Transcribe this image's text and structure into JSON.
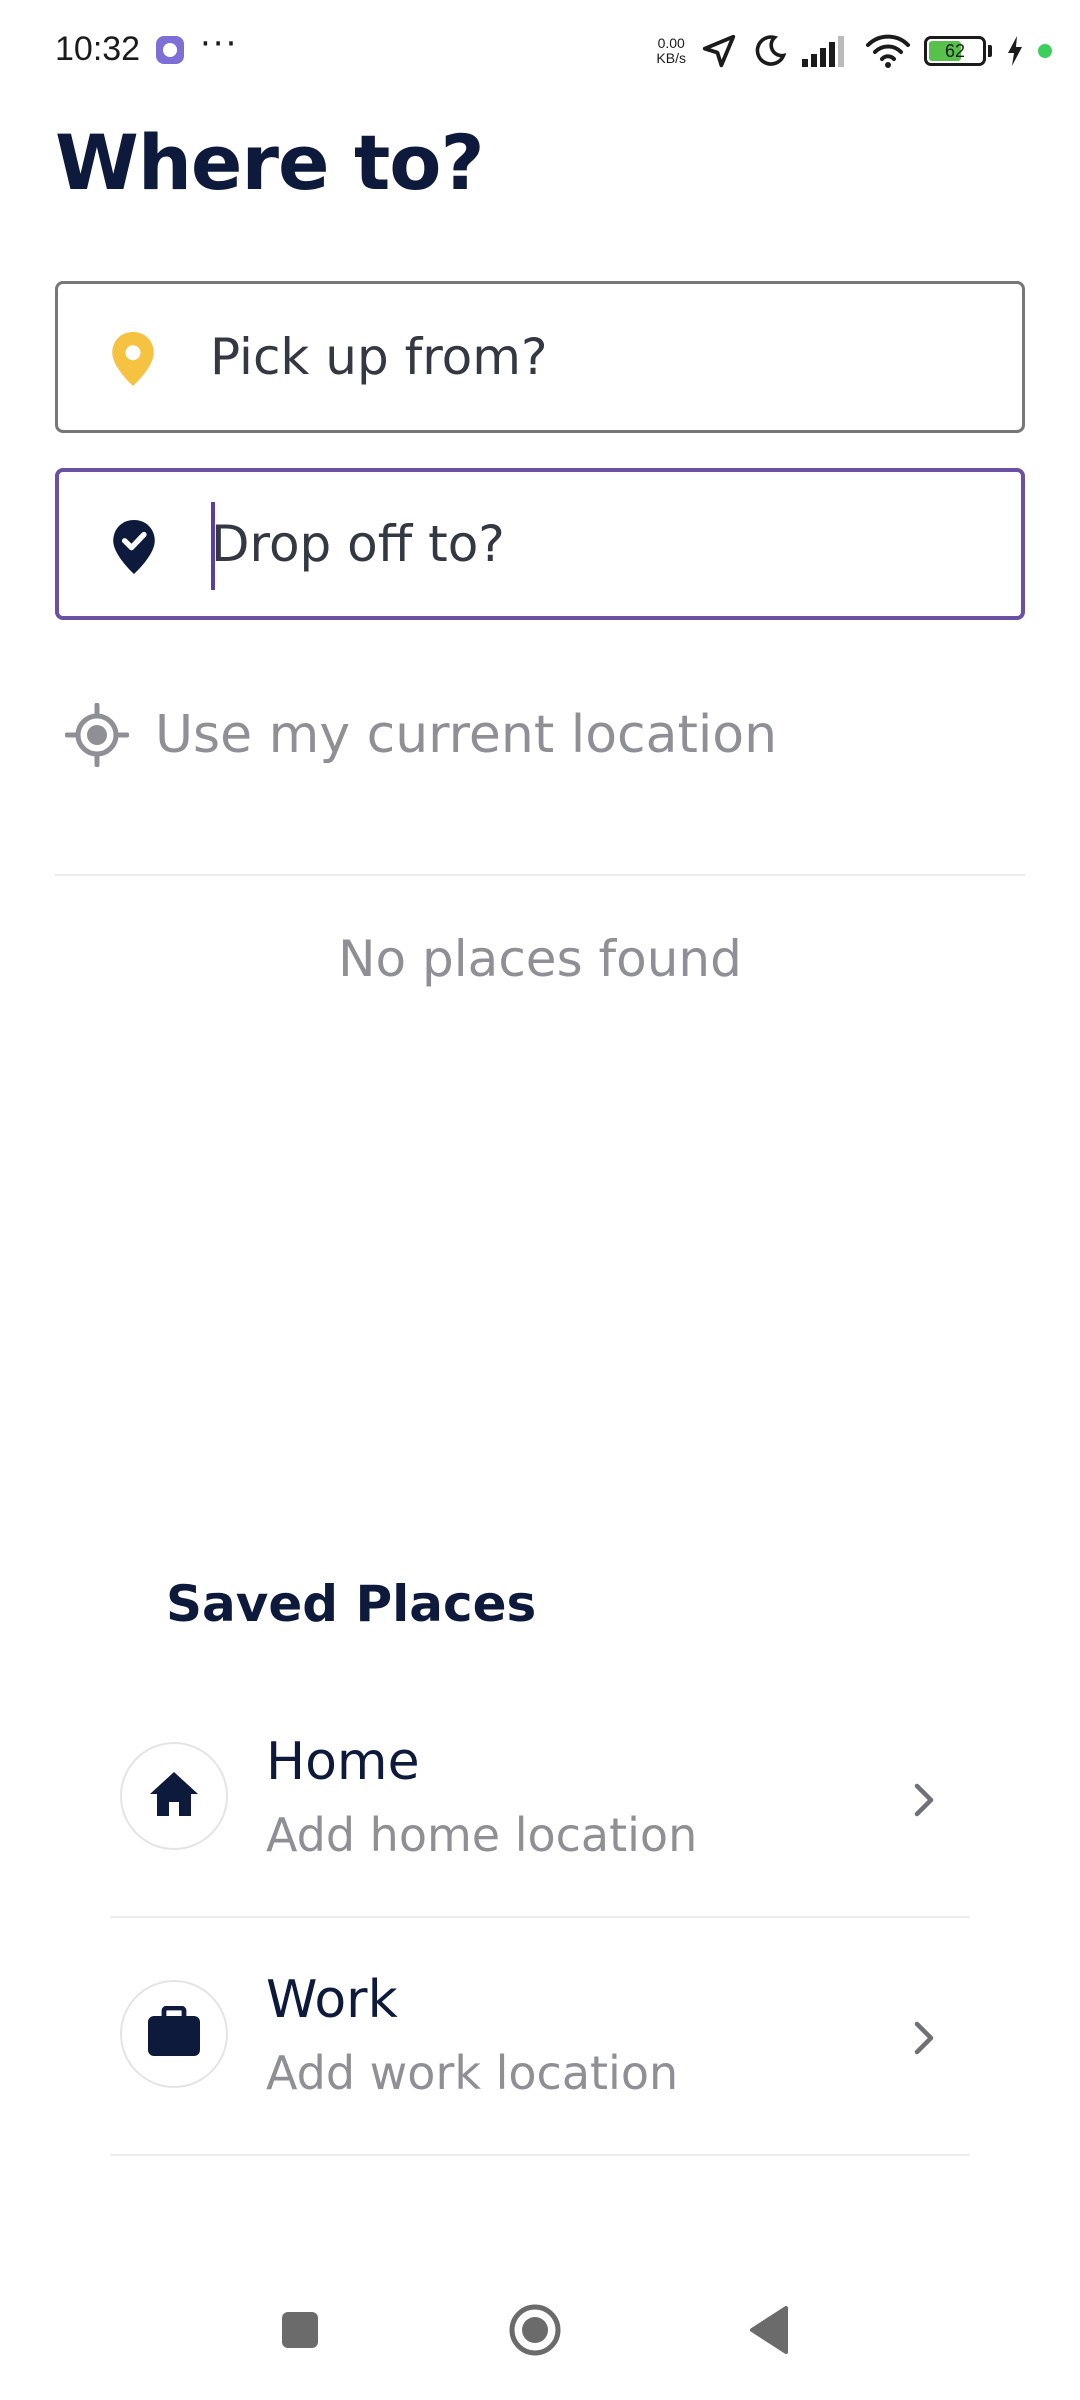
{
  "status_bar": {
    "time": "10:32",
    "more": "···",
    "speed_value": "0.00",
    "speed_unit": "KB/s",
    "battery_level": "62",
    "battery_fraction": 0.62,
    "battery_color": "#57c14b",
    "icons": [
      "app-notification-icon",
      "location-arrow-icon",
      "moon-icon",
      "signal-icon",
      "wifi-icon",
      "battery-icon",
      "charging-bolt-icon",
      "green-dot-indicator"
    ]
  },
  "page": {
    "title": "Where to?"
  },
  "pickup": {
    "placeholder": "Pick up from?",
    "icon": "location-pin-icon",
    "icon_color": "#f5c242"
  },
  "dropoff": {
    "placeholder": "Drop off to?",
    "icon": "check-pin-icon",
    "border_color": "#6a51a3"
  },
  "current_location": {
    "label": "Use my current location",
    "icon": "crosshair-icon"
  },
  "results": {
    "empty_message": "No places found"
  },
  "saved_places": {
    "title": "Saved Places",
    "items": [
      {
        "name": "Home",
        "subtitle": "Add home location",
        "icon": "house-icon"
      },
      {
        "name": "Work",
        "subtitle": "Add work location",
        "icon": "briefcase-icon"
      }
    ]
  },
  "nav_bar": {
    "buttons": [
      "recents-button",
      "home-button",
      "back-button"
    ]
  },
  "colors": {
    "title": "#0e1a3c",
    "muted": "#8e9095",
    "accent": "#6a51a3",
    "pin_yellow": "#f5c242"
  }
}
